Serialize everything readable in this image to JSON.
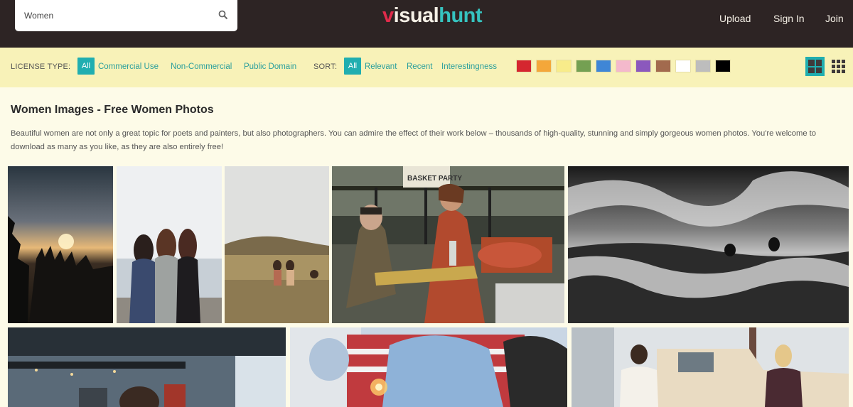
{
  "search": {
    "value": "Women"
  },
  "logo": {
    "part1": "v",
    "part2": "isual",
    "part3": "hunt"
  },
  "nav": {
    "upload": "Upload",
    "sign_in": "Sign In",
    "join": "Join"
  },
  "filters": {
    "license_label": "LICENSE TYPE:",
    "license_all": "All",
    "license_options": [
      "Commercial Use",
      "Non-Commercial",
      "Public Domain"
    ],
    "sort_label": "SORT:",
    "sort_all": "All",
    "sort_options": [
      "Relevant",
      "Recent",
      "Interestingness"
    ],
    "color_swatches": [
      "#d5262f",
      "#f4a73a",
      "#f8ec8a",
      "#74a052",
      "#3f86d6",
      "#f4b9cc",
      "#8b58bd",
      "#a26a4e",
      "#ffffff",
      "#bdbdbd",
      "#000000"
    ],
    "view_modes": [
      "large-grid",
      "small-grid"
    ],
    "active_view": "large-grid"
  },
  "page": {
    "title": "Women Images - Free Women Photos",
    "description": "Beautiful women are not only a great topic for poets and painters, but also photographers. You can admire the effect of their work below – thousands of high-quality, stunning and simply gorgeous women photos. You're welcome to download as many as you like, as they are also entirely free!"
  },
  "photo_sign_text": "BASKET PARTY",
  "accent": "#20aeb0",
  "header_bg": "#2d2424",
  "filter_bg": "#f8f2b8"
}
